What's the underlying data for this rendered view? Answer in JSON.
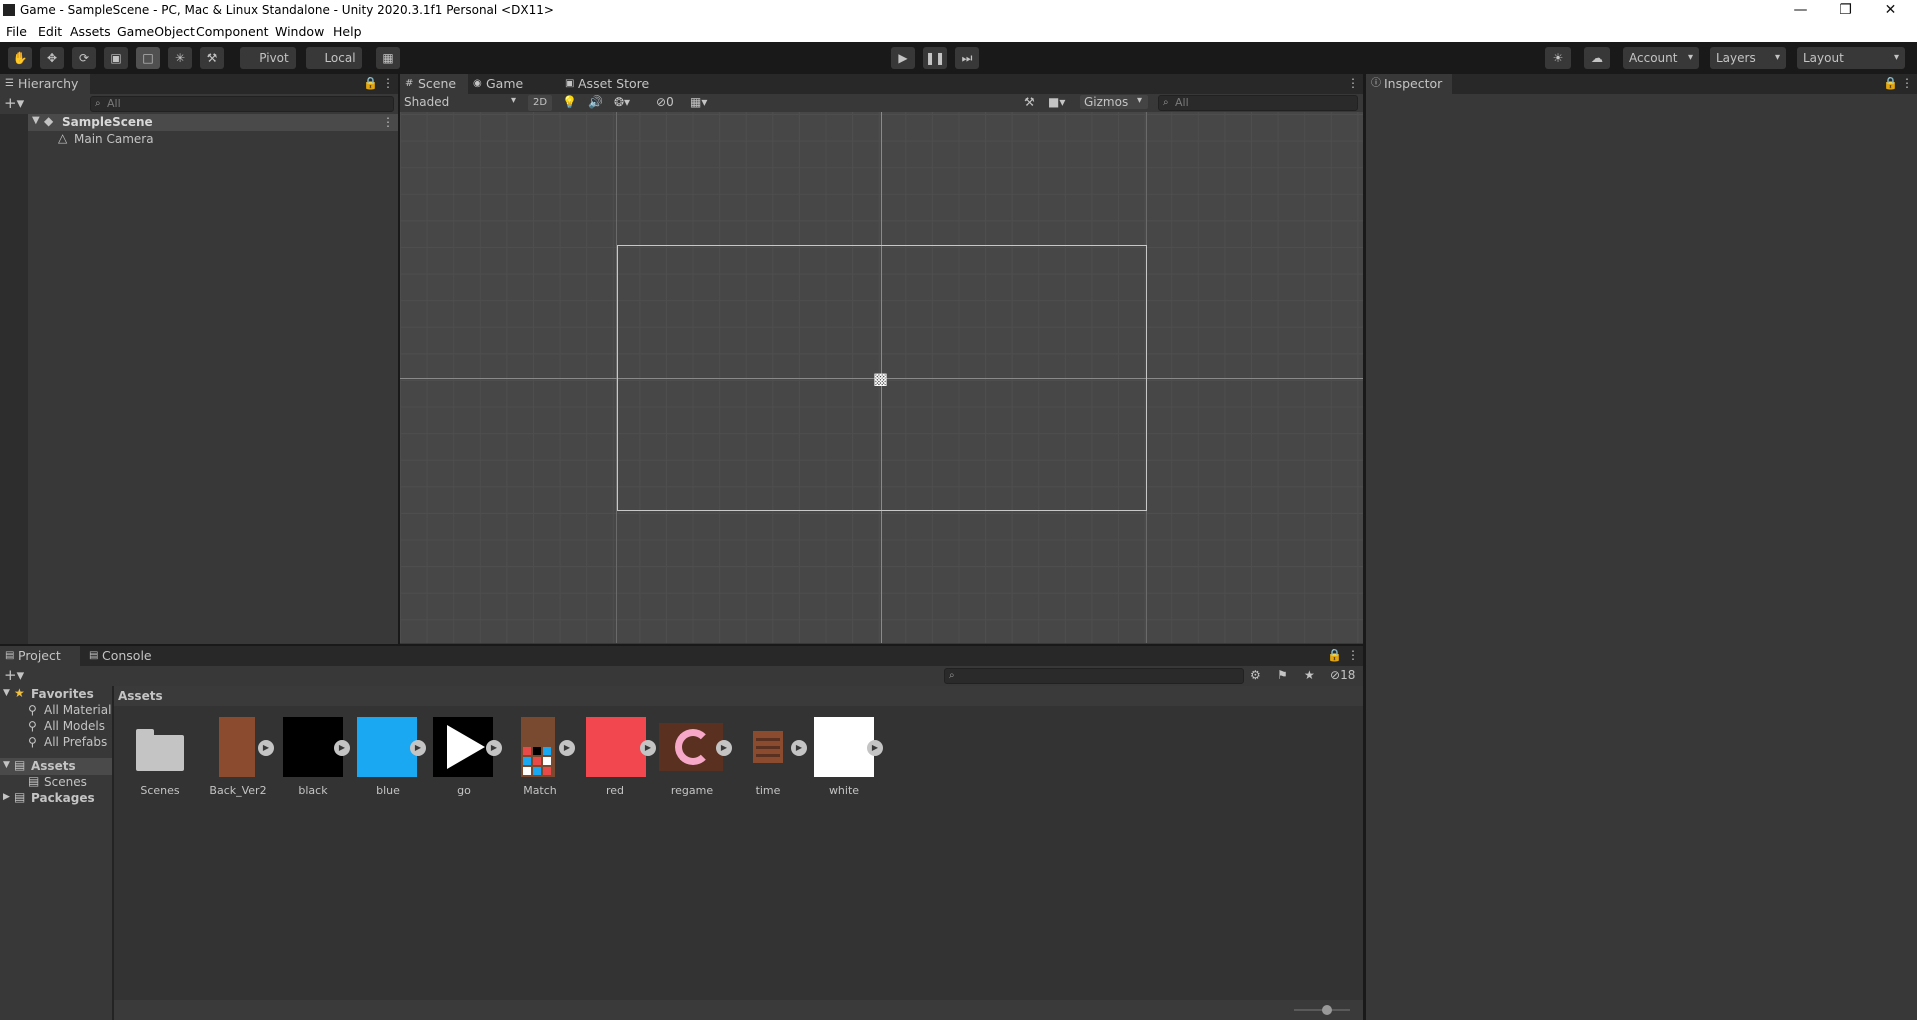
{
  "window": {
    "title": "Game - SampleScene - PC, Mac & Linux Standalone - Unity 2020.3.1f1 Personal <DX11>"
  },
  "menu": [
    "File",
    "Edit",
    "Assets",
    "GameObject",
    "Component",
    "Window",
    "Help"
  ],
  "toolbar": {
    "pivot": "Pivot",
    "local": "Local",
    "account": "Account",
    "layers": "Layers",
    "layout": "Layout"
  },
  "hierarchy": {
    "tab": "Hierarchy",
    "search_placeholder": "All",
    "scene": "SampleScene",
    "items": [
      "Main Camera"
    ]
  },
  "scene_view": {
    "tabs": [
      "Scene",
      "Game",
      "Asset Store"
    ],
    "shading": "Shaded",
    "mode2d": "2D",
    "hidden_count": "0",
    "gizmos": "Gizmos",
    "search_placeholder": "All"
  },
  "inspector": {
    "tab": "Inspector"
  },
  "project": {
    "tabs": [
      "Project",
      "Console"
    ],
    "hidden_count": "18",
    "breadcrumb": "Assets",
    "favorites": {
      "label": "Favorites",
      "items": [
        "All Materials",
        "All Models",
        "All Prefabs"
      ]
    },
    "tree": {
      "assets": "Assets",
      "scenes": "Scenes",
      "packages": "Packages"
    },
    "assets": [
      {
        "name": "Scenes",
        "kind": "folder"
      },
      {
        "name": "Back_Ver2",
        "color": "#8a4b2e"
      },
      {
        "name": "black",
        "color": "#000000"
      },
      {
        "name": "blue",
        "color": "#1aa8f2"
      },
      {
        "name": "go",
        "color": "#000000"
      },
      {
        "name": "Match",
        "color": "#7a4a30"
      },
      {
        "name": "red",
        "color": "#f2474f"
      },
      {
        "name": "regame",
        "color": "#5a3020"
      },
      {
        "name": "time",
        "color": "#383838"
      },
      {
        "name": "white",
        "color": "#ffffff"
      }
    ]
  }
}
